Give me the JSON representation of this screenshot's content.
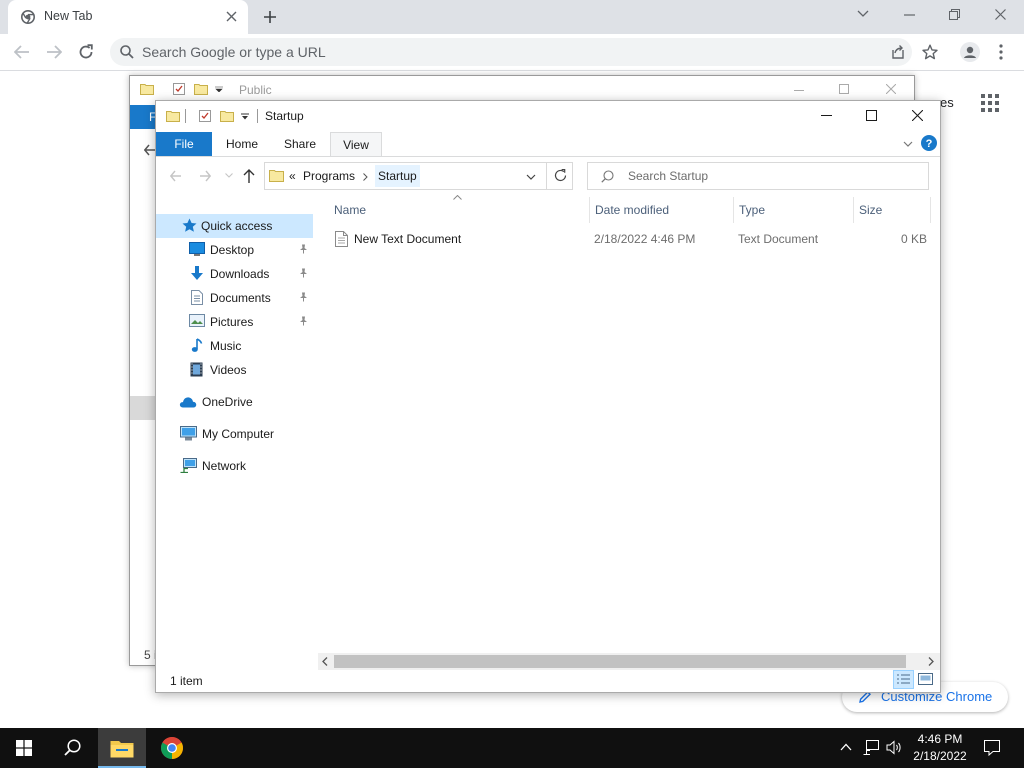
{
  "browser": {
    "tab_title": "New Tab",
    "omnibox_placeholder": "Search Google or type a URL",
    "shortcut_partial_text": "es",
    "customize_label": "Customize Chrome"
  },
  "back_window": {
    "title": "Public",
    "ribbon_partial": "F",
    "status_partial": "5 i"
  },
  "explorer": {
    "title": "Startup",
    "tabs": [
      "File",
      "Home",
      "Share",
      "View"
    ],
    "breadcrumb": {
      "overflow": "«",
      "items": [
        "Programs",
        "Startup"
      ]
    },
    "search_placeholder": "Search Startup",
    "nav": {
      "quick_access": "Quick access",
      "pinned": [
        "Desktop",
        "Downloads",
        "Documents",
        "Pictures"
      ],
      "unpinned": [
        "Music",
        "Videos"
      ],
      "onedrive": "OneDrive",
      "computer": "My Computer",
      "network": "Network"
    },
    "columns": {
      "name": "Name",
      "date": "Date modified",
      "type": "Type",
      "size": "Size"
    },
    "files": [
      {
        "name": "New Text Document",
        "date": "2/18/2022 4:46 PM",
        "type": "Text Document",
        "size": "0 KB"
      }
    ],
    "status": "1 item"
  },
  "taskbar": {
    "time": "4:46 PM",
    "date": "2/18/2022"
  },
  "colors": {
    "file_tab": "#1979ca",
    "selection": "#cce8ff",
    "taskbar": "#101010",
    "chrome_strip": "#dee1e6",
    "link_blue": "#1a73e8"
  }
}
